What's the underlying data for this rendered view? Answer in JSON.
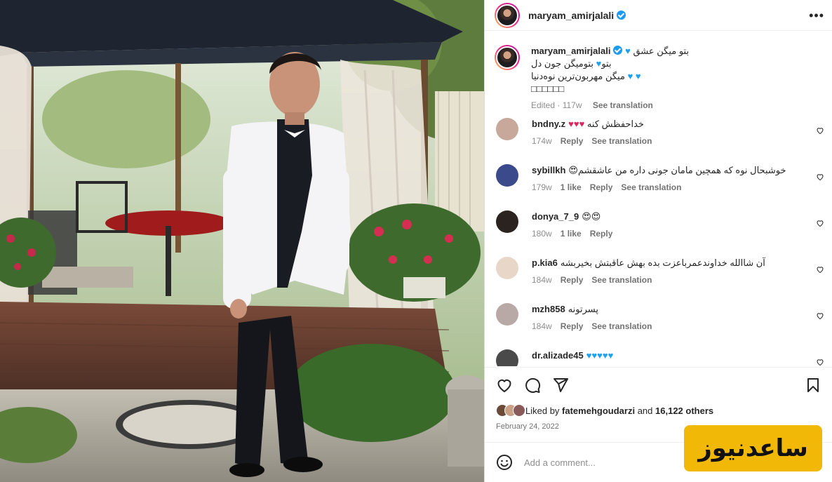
{
  "post": {
    "username": "maryam_amirjalali",
    "verified": true,
    "more_icon": "ellipsis-icon"
  },
  "caption": {
    "username": "maryam_amirjalali",
    "line1": "بتو میگن عشق",
    "line2": "بتومیگن جون دل",
    "line2b": "بتو",
    "line3": "میگن مهربون‌ترین نوه‌دنیا",
    "line4": "□□□□□□",
    "edited": "Edited · 117w",
    "see_translation": "See translation"
  },
  "comments": [
    {
      "user": "bndny.z",
      "text": "خداحفظش کنه",
      "emoji": "♥♥♥",
      "emoji_color": "#e0245e",
      "time": "174w",
      "likes": "",
      "reply": "Reply",
      "translate": "See translation",
      "avatar_color": "#c7a89a"
    },
    {
      "user": "sybillkh",
      "text": "خوشبحال نوه که همچین مامان جونی داره من عاشقشم",
      "emoji": "😍",
      "emoji_color": "",
      "time": "179w",
      "likes": "1 like",
      "reply": "Reply",
      "translate": "See translation",
      "avatar_color": "#3a4a8a"
    },
    {
      "user": "donya_7_9",
      "text": "",
      "emoji": "😍😍",
      "emoji_color": "",
      "time": "180w",
      "likes": "1 like",
      "reply": "Reply",
      "translate": "",
      "avatar_color": "#2b2320"
    },
    {
      "user": "p.kia6",
      "text": "آن شاالله خداوندعمرباعزت بده بهش عاقبتش بخیربشه",
      "emoji": "",
      "emoji_color": "",
      "time": "184w",
      "likes": "",
      "reply": "Reply",
      "translate": "See translation",
      "avatar_color": "#e8d6c8"
    },
    {
      "user": "mzh858",
      "text": "پسرتونه",
      "emoji": "",
      "emoji_color": "",
      "time": "184w",
      "likes": "",
      "reply": "Reply",
      "translate": "See translation",
      "avatar_color": "#b9a9a6"
    },
    {
      "user": "dr.alizade45",
      "text": "",
      "emoji": "♥♥♥♥♥",
      "emoji_color": "#1da1f2",
      "time": "",
      "likes": "",
      "reply": "",
      "translate": "",
      "avatar_color": "#4a4a4a"
    }
  ],
  "likes": {
    "prefix": "Liked by",
    "user": "fatemehgoudarzi",
    "and": "and",
    "others": "16,122 others",
    "date": "February 24, 2022"
  },
  "add_comment": {
    "placeholder": "Add a comment..."
  },
  "watermark": {
    "text": "ساعدنیوز"
  }
}
